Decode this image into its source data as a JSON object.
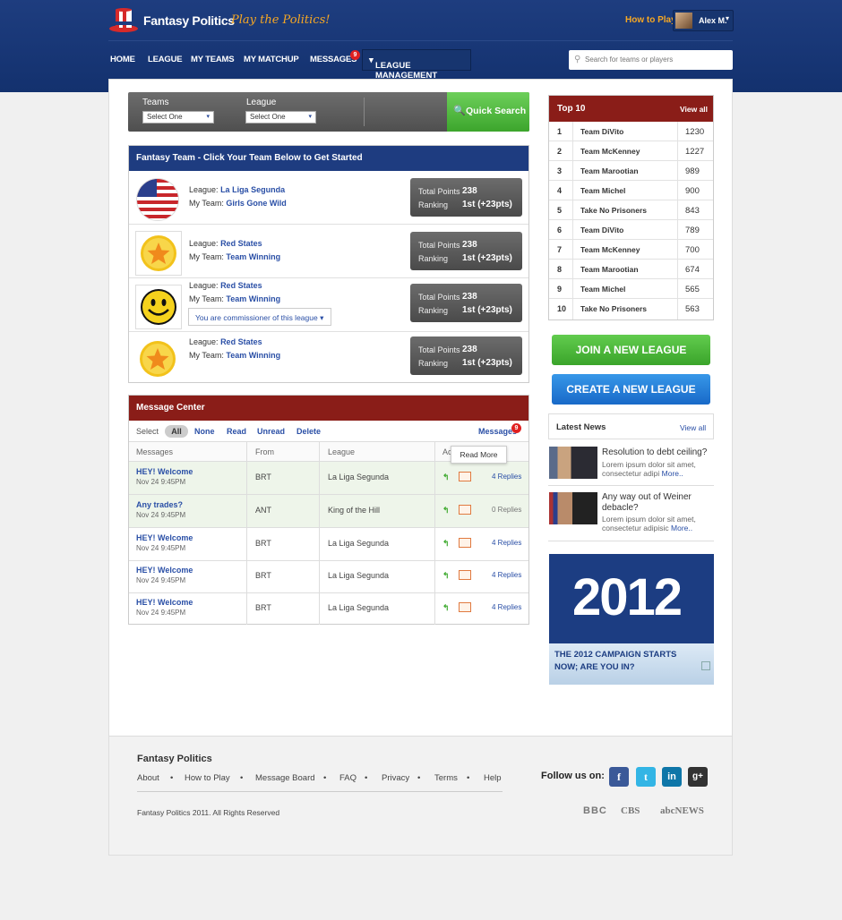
{
  "brand": {
    "name": "Fantasy Politics",
    "tagline": "Play the Politics!"
  },
  "header": {
    "how_to_play": "How to Play",
    "user_name": "Alex M."
  },
  "nav": {
    "items": [
      "HOME",
      "LEAGUE",
      "MY TEAMS",
      "MY MATCHUP",
      "MESSAGES"
    ],
    "messages_badge": "9",
    "league_management": "LEAGUE MANAGEMENT"
  },
  "search": {
    "placeholder": "Search for teams or players"
  },
  "quick_search": {
    "teams_label": "Teams",
    "league_label": "League",
    "teams_value": "Select One",
    "league_value": "Select One",
    "button": "Quick Search"
  },
  "fantasy_team": {
    "title": "Fantasy Team - Click Your Team Below to Get Started",
    "league_label": "League:",
    "team_label": "My Team:",
    "points_label": "Total Points",
    "ranking_label": "Ranking",
    "rows": [
      {
        "league": "La Liga Segunda",
        "team": "Girls Gone Wild",
        "points": "238",
        "ranking": "1st (+23pts)"
      },
      {
        "league": "Red States",
        "team": "Team Winning",
        "points": "238",
        "ranking": "1st (+23pts)"
      },
      {
        "league": "Red States",
        "team": "Team Winning",
        "points": "238",
        "ranking": "1st (+23pts)",
        "commissioner": "You are commissioner of this league"
      },
      {
        "league": "Red States",
        "team": "Team Winning",
        "points": "238",
        "ranking": "1st (+23pts)"
      }
    ]
  },
  "message_center": {
    "title": "Message Center",
    "select_label": "Select",
    "filters": [
      "All",
      "None",
      "Read",
      "Unread",
      "Delete"
    ],
    "messages_link": "Messages",
    "messages_badge": "9",
    "columns": [
      "Messages",
      "From",
      "League",
      "Ac"
    ],
    "tooltip": "Read More",
    "rows": [
      {
        "subject": "HEY! Welcome",
        "date": "Nov 24 9:45PM",
        "from": "BRT",
        "league": "La Liga Segunda",
        "replies": "4 Replies"
      },
      {
        "subject": "Any trades?",
        "date": "Nov 24 9:45PM",
        "from": "ANT",
        "league": "King of the Hill",
        "replies": "0 Replies"
      },
      {
        "subject": "HEY! Welcome",
        "date": "Nov 24 9:45PM",
        "from": "BRT",
        "league": "La Liga Segunda",
        "replies": "4 Replies"
      },
      {
        "subject": "HEY! Welcome",
        "date": "Nov 24 9:45PM",
        "from": "BRT",
        "league": "La Liga Segunda",
        "replies": "4 Replies"
      },
      {
        "subject": "HEY! Welcome",
        "date": "Nov 24 9:45PM",
        "from": "BRT",
        "league": "La Liga Segunda",
        "replies": "4 Replies"
      }
    ]
  },
  "top10": {
    "title": "Top 10",
    "view_all": "View all",
    "rows": [
      {
        "rank": "1",
        "team": "Team DiVito",
        "points": "1230"
      },
      {
        "rank": "2",
        "team": "Team McKenney",
        "points": "1227"
      },
      {
        "rank": "3",
        "team": "Team Marootian",
        "points": "989"
      },
      {
        "rank": "4",
        "team": "Team Michel",
        "points": "900"
      },
      {
        "rank": "5",
        "team": "Take No Prisoners",
        "points": "843"
      },
      {
        "rank": "6",
        "team": "Team DiVito",
        "points": "789"
      },
      {
        "rank": "7",
        "team": "Team McKenney",
        "points": "700"
      },
      {
        "rank": "8",
        "team": "Team Marootian",
        "points": "674"
      },
      {
        "rank": "9",
        "team": "Team Michel",
        "points": "565"
      },
      {
        "rank": "10",
        "team": "Take No Prisoners",
        "points": "563"
      }
    ]
  },
  "actions": {
    "join": "JOIN A NEW LEAGUE",
    "create": "CREATE A NEW LEAGUE"
  },
  "news": {
    "title": "Latest News",
    "view_all": "View all",
    "items": [
      {
        "title": "Resolution to debt ceiling?",
        "text": "Lorem ipsum dolor sit amet, consectetur adipi",
        "more": "More.."
      },
      {
        "title": "Any way out of Weiner debacle?",
        "text": "Lorem ipsum dolor sit amet, consectetur adipisic",
        "more": "More.."
      }
    ]
  },
  "ad": {
    "year": "2012",
    "text": "THE 2012 CAMPAIGN STARTS NOW; ARE YOU IN?"
  },
  "footer": {
    "title": "Fantasy Politics",
    "links": [
      "About",
      "How to Play",
      "Message Board",
      "FAQ",
      "Privacy",
      "Terms",
      "Help"
    ],
    "copyright": "Fantasy Politics 2011. All Rights Reserved",
    "follow": "Follow us on:",
    "social": [
      "f",
      "t",
      "in",
      "g+"
    ],
    "media": [
      "BBC",
      "CBS",
      "abcNEWS"
    ]
  },
  "colors": {
    "navy": "#1e3c80",
    "red": "#8a1d18",
    "green": "#4cb83a",
    "blue": "#1f7fd8",
    "orange": "#f7a823"
  }
}
